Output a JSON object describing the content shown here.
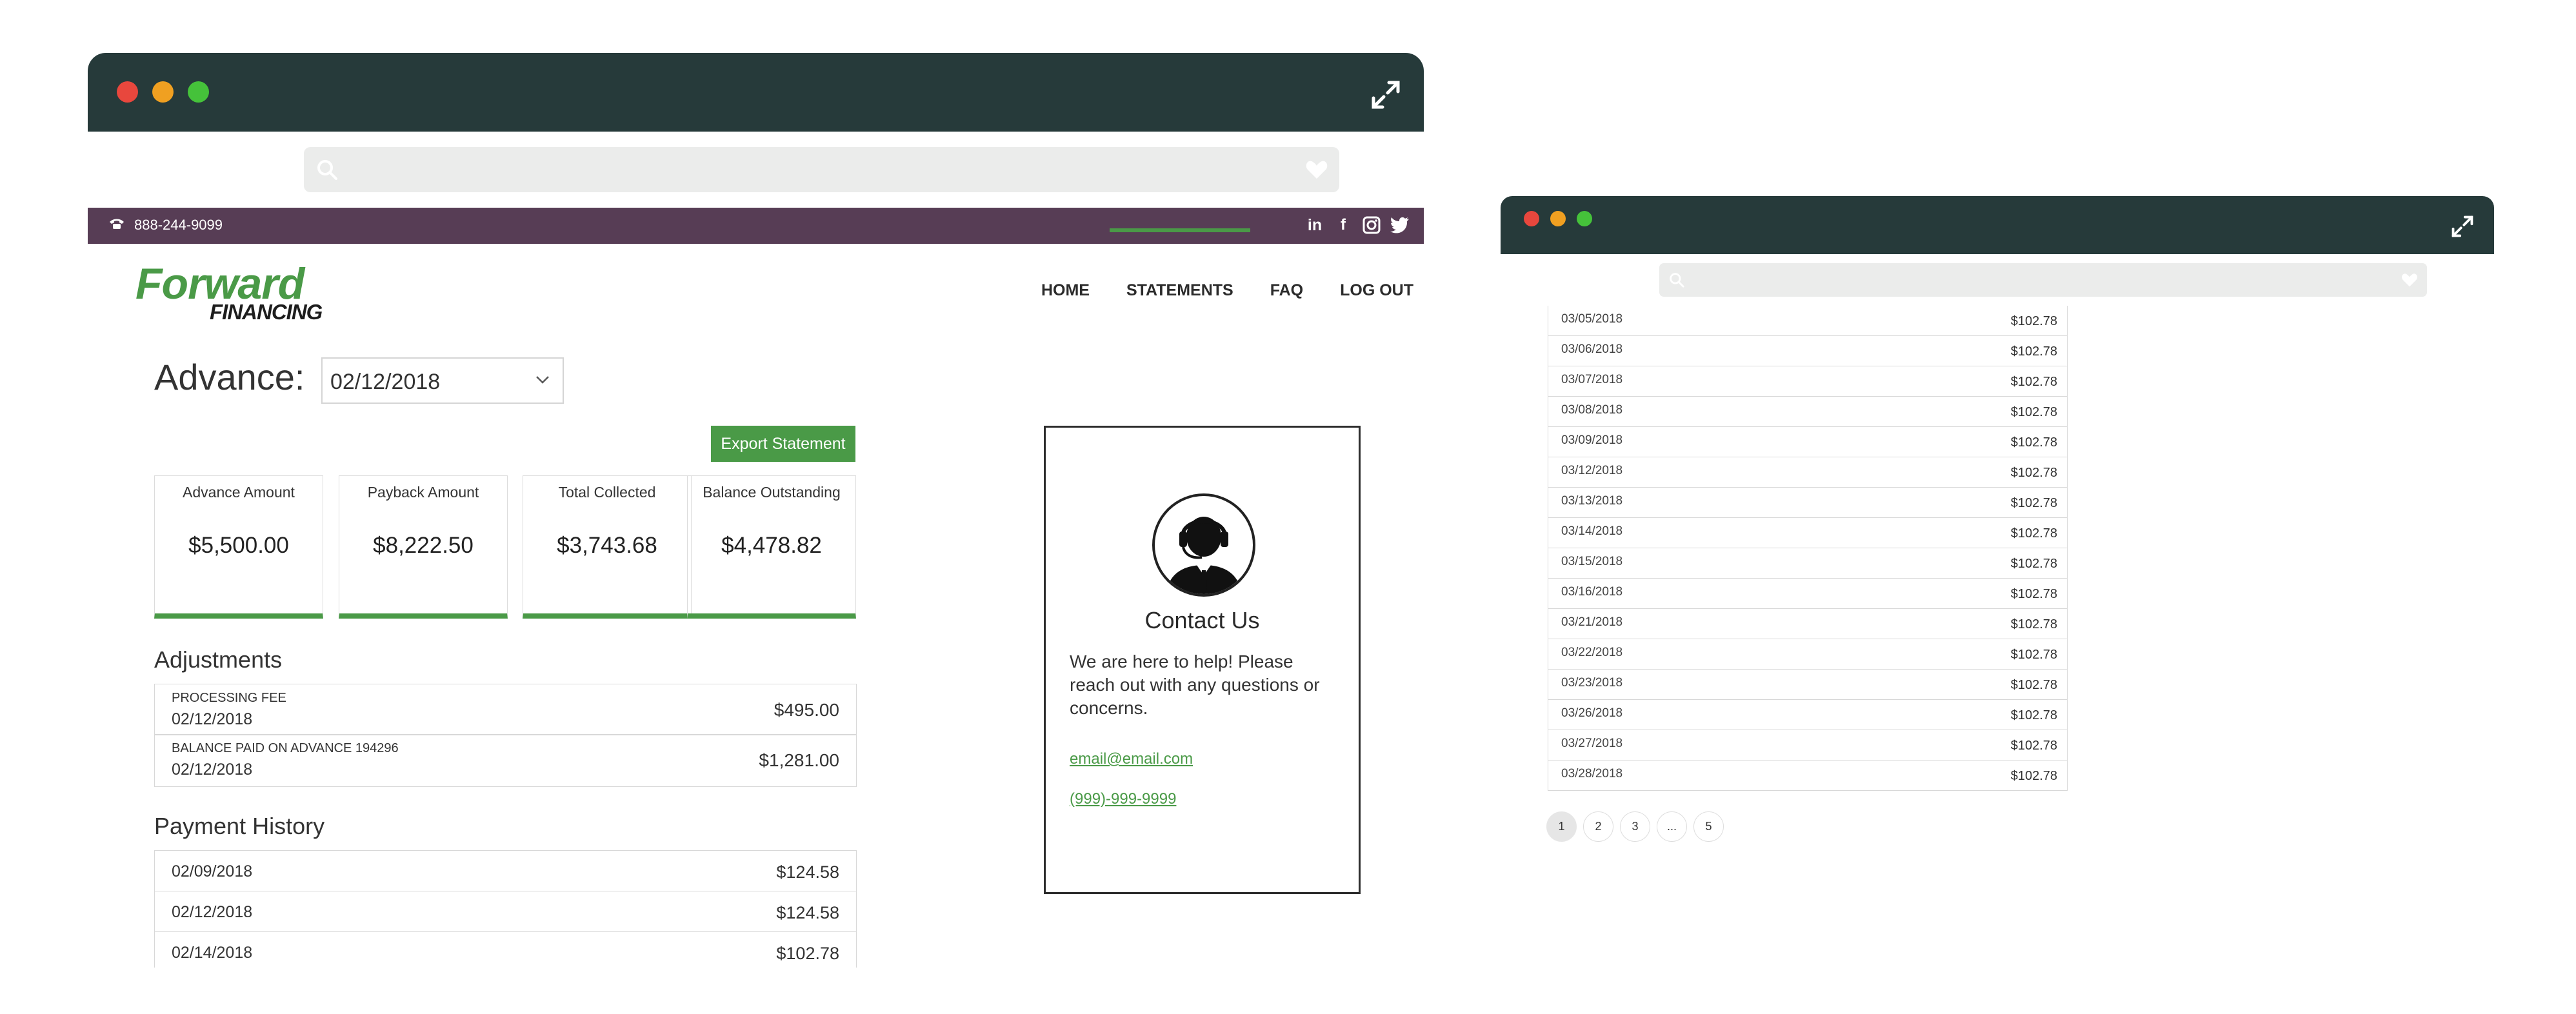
{
  "colors": {
    "chrome": "#263a3a",
    "brand_green": "#4a9a47",
    "topbar_purple": "#573d55"
  },
  "window_main": {
    "topbar": {
      "phone": "888-244-9099",
      "social_icons": [
        "linkedin-icon",
        "facebook-icon",
        "instagram-icon",
        "twitter-icon"
      ]
    },
    "logo": {
      "line1": "Forward",
      "line2": "FINANCING"
    },
    "nav": [
      {
        "label": "HOME"
      },
      {
        "label": "STATEMENTS",
        "active": true
      },
      {
        "label": "FAQ"
      },
      {
        "label": "LOG OUT"
      }
    ],
    "advance": {
      "label": "Advance:",
      "selected_date": "02/12/2018"
    },
    "export_button": "Export Statement",
    "stats": [
      {
        "label": "Advance Amount",
        "value": "$5,500.00"
      },
      {
        "label": "Payback Amount",
        "value": "$8,222.50"
      },
      {
        "label": "Total Collected",
        "value": "$3,743.68"
      },
      {
        "label": "Balance Outstanding",
        "value": "$4,478.82"
      }
    ],
    "adjustments": {
      "title": "Adjustments",
      "rows": [
        {
          "type": "PROCESSING FEE",
          "date": "02/12/2018",
          "amount": "$495.00"
        },
        {
          "type": "BALANCE PAID ON ADVANCE 194296",
          "date": "02/12/2018",
          "amount": "$1,281.00"
        }
      ]
    },
    "payment_history": {
      "title": "Payment History",
      "rows": [
        {
          "date": "02/09/2018",
          "amount": "$124.58"
        },
        {
          "date": "02/12/2018",
          "amount": "$124.58"
        },
        {
          "date": "02/14/2018",
          "amount": "$102.78"
        }
      ]
    },
    "contact": {
      "title": "Contact Us",
      "body": "We are here to help! Please reach out with any questions or concerns.",
      "email": "email@email.com",
      "phone": "(999)-999-9999"
    }
  },
  "window_secondary": {
    "payments": [
      {
        "date": "03/05/2018",
        "amount": "$102.78"
      },
      {
        "date": "03/06/2018",
        "amount": "$102.78"
      },
      {
        "date": "03/07/2018",
        "amount": "$102.78"
      },
      {
        "date": "03/08/2018",
        "amount": "$102.78"
      },
      {
        "date": "03/09/2018",
        "amount": "$102.78"
      },
      {
        "date": "03/12/2018",
        "amount": "$102.78"
      },
      {
        "date": "03/13/2018",
        "amount": "$102.78"
      },
      {
        "date": "03/14/2018",
        "amount": "$102.78"
      },
      {
        "date": "03/15/2018",
        "amount": "$102.78"
      },
      {
        "date": "03/16/2018",
        "amount": "$102.78"
      },
      {
        "date": "03/21/2018",
        "amount": "$102.78"
      },
      {
        "date": "03/22/2018",
        "amount": "$102.78"
      },
      {
        "date": "03/23/2018",
        "amount": "$102.78"
      },
      {
        "date": "03/26/2018",
        "amount": "$102.78"
      },
      {
        "date": "03/27/2018",
        "amount": "$102.78"
      },
      {
        "date": "03/28/2018",
        "amount": "$102.78"
      }
    ],
    "pagination": [
      "1",
      "2",
      "3",
      "...",
      "5"
    ],
    "current_page": "1"
  }
}
